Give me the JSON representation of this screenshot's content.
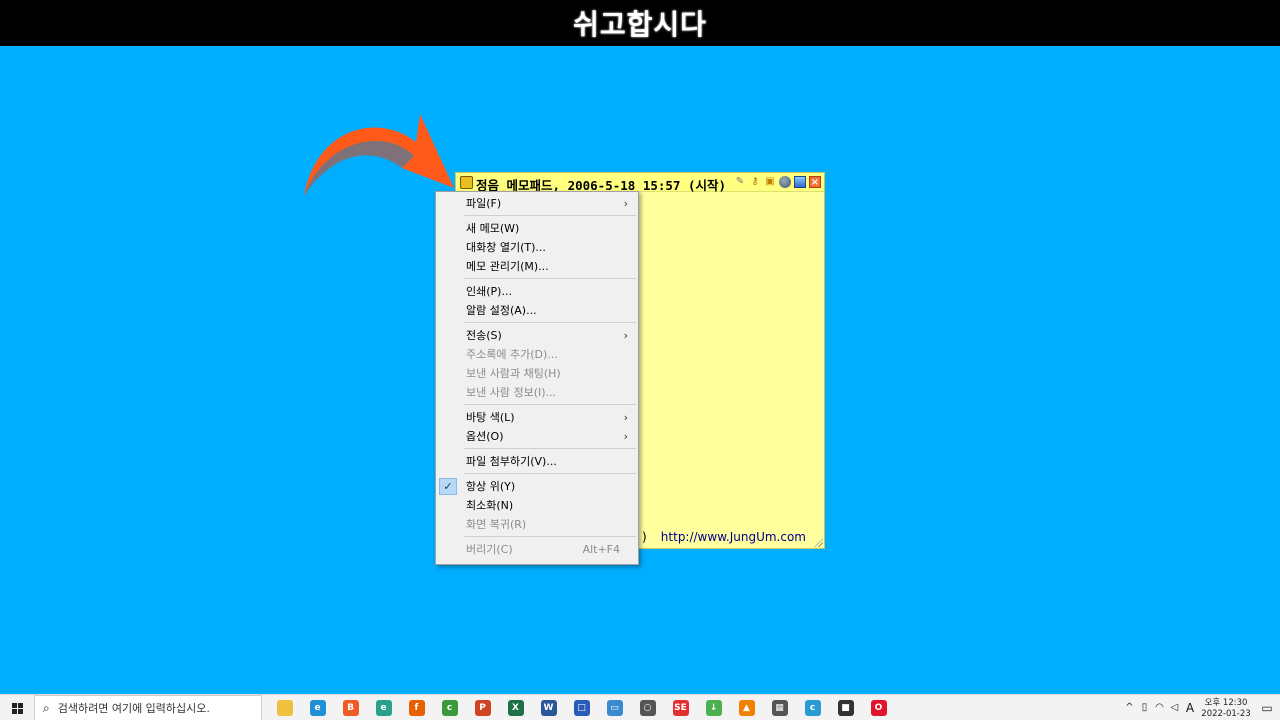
{
  "banner": {
    "title": "쉬고합시다"
  },
  "colors": {
    "desktop": "#00aeff",
    "memo_bg": "#ffff9e",
    "arrow": "#ff5a1a",
    "menu_bg": "#f0f0f0"
  },
  "memo": {
    "title": "정음 메모패드, 2006-5-18 15:57 (시작)",
    "url": "http://www.JungUm.com",
    "partial_text": ")",
    "titlebar_icons": [
      "pencil-icon",
      "key-icon",
      "lock-icon",
      "ball-icon",
      "window-icon",
      "close-icon"
    ]
  },
  "context_menu": {
    "items": [
      {
        "label": "파일(F)",
        "submenu": true,
        "enabled": true
      },
      {
        "separator": true
      },
      {
        "label": "새 메모(W)",
        "enabled": true
      },
      {
        "label": "대화창 열기(T)...",
        "enabled": true
      },
      {
        "label": "메모 관리기(M)...",
        "enabled": true
      },
      {
        "separator": true
      },
      {
        "label": "인쇄(P)...",
        "enabled": true
      },
      {
        "label": "알람 설정(A)...",
        "enabled": true
      },
      {
        "separator": true
      },
      {
        "label": "전송(S)",
        "submenu": true,
        "enabled": true
      },
      {
        "label": "주소록에 추가(D)...",
        "enabled": false
      },
      {
        "label": "보낸 사람과 채팅(H)",
        "enabled": false
      },
      {
        "label": "보낸 사람 정보(I)...",
        "enabled": false
      },
      {
        "separator": true
      },
      {
        "label": "바탕 색(L)",
        "submenu": true,
        "enabled": true
      },
      {
        "label": "옵션(O)",
        "submenu": true,
        "enabled": true
      },
      {
        "separator": true
      },
      {
        "label": "파일 첨부하기(V)...",
        "enabled": true
      },
      {
        "separator": true
      },
      {
        "label": "항상 위(Y)",
        "checked": true,
        "enabled": true
      },
      {
        "label": "최소화(N)",
        "enabled": true
      },
      {
        "label": "화면 복귀(R)",
        "enabled": false
      },
      {
        "separator": true
      },
      {
        "label": "버리기(C)",
        "shortcut": "Alt+F4",
        "enabled": false
      }
    ]
  },
  "taskbar": {
    "search_placeholder": "검색하려면 여기에 입력하십시오.",
    "apps": [
      {
        "name": "file-explorer-icon",
        "color": "#f0c040",
        "glyph": ""
      },
      {
        "name": "edge-icon",
        "color": "#1f8fd6",
        "glyph": "e"
      },
      {
        "name": "brave-icon",
        "color": "#f05a24",
        "glyph": "B"
      },
      {
        "name": "edge-dev-icon",
        "color": "#2aa08a",
        "glyph": "e"
      },
      {
        "name": "firefox-icon",
        "color": "#e66000",
        "glyph": "f"
      },
      {
        "name": "chrome-icon",
        "color": "#3b9a3b",
        "glyph": "c"
      },
      {
        "name": "powerpoint-icon",
        "color": "#d04423",
        "glyph": "P"
      },
      {
        "name": "excel-icon",
        "color": "#1e7145",
        "glyph": "X"
      },
      {
        "name": "word-icon",
        "color": "#2b579a",
        "glyph": "W"
      },
      {
        "name": "app-blue-icon",
        "color": "#2a5ab8",
        "glyph": "□"
      },
      {
        "name": "remote-desktop-icon",
        "color": "#3a8ad0",
        "glyph": "▭"
      },
      {
        "name": "search-tool-icon",
        "color": "#555555",
        "glyph": "○"
      },
      {
        "name": "se-app-icon",
        "color": "#e03030",
        "glyph": "SE"
      },
      {
        "name": "download-app-icon",
        "color": "#4caf50",
        "glyph": "↓"
      },
      {
        "name": "vlc-icon",
        "color": "#f08000",
        "glyph": "▲"
      },
      {
        "name": "calculator-icon",
        "color": "#555555",
        "glyph": "▦"
      },
      {
        "name": "chrome-beta-icon",
        "color": "#2a9ad0",
        "glyph": "c"
      },
      {
        "name": "sticky-notes-icon",
        "color": "#333333",
        "glyph": "■"
      },
      {
        "name": "opera-icon",
        "color": "#e0142c",
        "glyph": "O"
      }
    ],
    "ime_label": "A",
    "clock_time": "오후 12:30",
    "clock_date": "2022-01-23"
  }
}
